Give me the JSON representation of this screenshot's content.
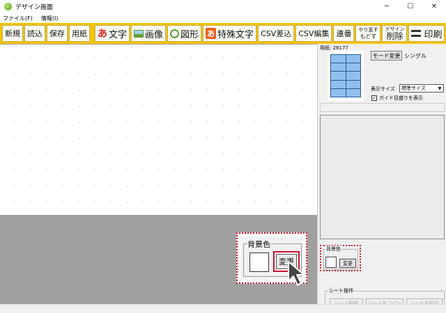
{
  "window": {
    "title": "デザイン画面",
    "controls": [
      "─",
      "☐",
      "✕"
    ]
  },
  "menu": [
    "ファイル(F)",
    "情報(I)"
  ],
  "toolbar": {
    "new": "新規",
    "load": "読込",
    "save": "保存",
    "paper": "用紙",
    "text_icon": "あ",
    "text": "文字",
    "image": "画像",
    "shape": "図形",
    "special_icon": "あ",
    "special_text": "特殊文字",
    "csv_insert": "CSV差込",
    "csv_edit": "CSV編集",
    "serial": "連番",
    "redo": "やり直す",
    "undo": "もどす",
    "design_small": "デザイン",
    "design_delete": "削除",
    "print": "印刷"
  },
  "panel": {
    "paper_label": "用紙: 28177",
    "mode_button": "モード変更",
    "mode_value": "シングル",
    "size_label": "表示サイズ",
    "size_value": "標準サイズ",
    "guide_label": "ガイド目盛りを表示",
    "guide_checked": true,
    "sheet_group": "シート操作",
    "sheet_delete": "シート削除",
    "sheet_copy": "シートをコピー",
    "sheet_paste": "シートを貼付"
  },
  "background": {
    "label": "背景色",
    "change_button": "変更",
    "color": "#ffffff"
  },
  "colors": {
    "toolbar": "#f5c400",
    "canvas_bg": "#a0a0a0",
    "callout_border": "#c8102e",
    "thumb_cell": "#8fc0ee"
  }
}
